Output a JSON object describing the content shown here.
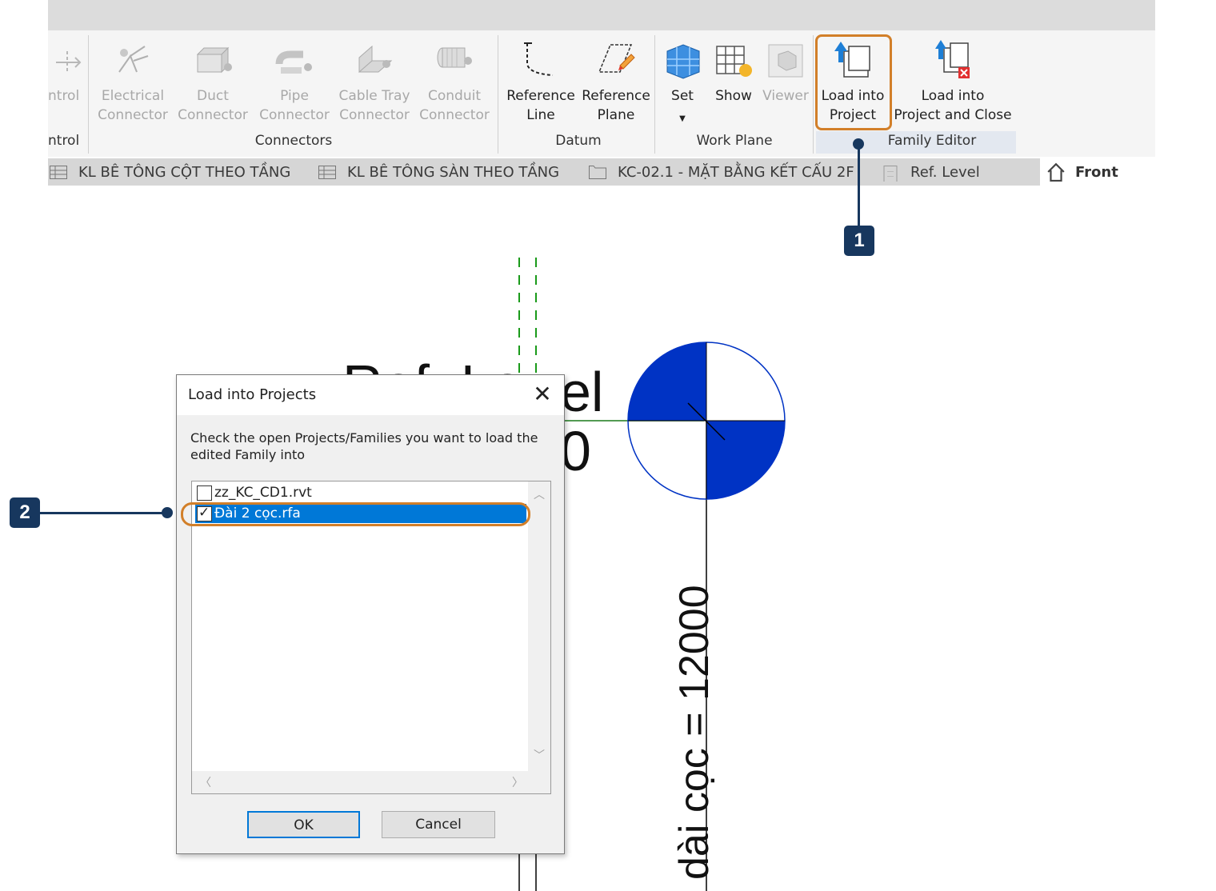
{
  "ribbon": {
    "control_label": "ntrol",
    "control_panel_title": "ntrol",
    "connectors": [
      {
        "label": "Electrical\nConnector",
        "icon": "electrical-connector-icon"
      },
      {
        "label": "Duct\nConnector",
        "icon": "duct-connector-icon"
      },
      {
        "label": "Pipe\nConnector",
        "icon": "pipe-connector-icon"
      },
      {
        "label": "Cable Tray\nConnector",
        "icon": "cable-tray-connector-icon"
      },
      {
        "label": "Conduit\nConnector",
        "icon": "conduit-connector-icon"
      }
    ],
    "connectors_panel_title": "Connectors",
    "reference_line": "Reference\nLine",
    "reference_plane": "Reference\nPlane",
    "datum_panel_title": "Datum",
    "set": "Set",
    "show": "Show",
    "viewer": "Viewer",
    "work_plane_panel_title": "Work Plane",
    "load_into_project": "Load into\nProject",
    "load_into_project_and_close": "Load into\nProject and Close",
    "family_editor_panel_title": "Family Editor"
  },
  "view_tabs": [
    {
      "label": "KL BÊ TÔNG CỘT THEO TẦNG",
      "icon": "schedule-icon"
    },
    {
      "label": "KL BÊ TÔNG SÀN THEO TẦNG",
      "icon": "schedule-icon"
    },
    {
      "label": "KC-02.1 - MẶT BẰNG KẾT CẤU 2F",
      "icon": "sheet-icon"
    },
    {
      "label": "Ref. Level",
      "icon": "level-view-icon"
    },
    {
      "label": "Front",
      "icon": "elevation-view-icon",
      "active": true
    }
  ],
  "callouts": {
    "one": "1",
    "two": "2"
  },
  "drawing": {
    "dimension_text": "dài cọc = 12000",
    "level_label_partial": "el",
    "level_value_partial": "0"
  },
  "dialog": {
    "title": "Load into Projects",
    "message": "Check the open Projects/Families you want to load the edited Family into",
    "items": [
      {
        "name": "zz_KC_CD1.rvt",
        "checked": false
      },
      {
        "name": "Đài 2 cọc.rfa",
        "checked": true,
        "selected": true
      }
    ],
    "ok": "OK",
    "cancel": "Cancel"
  },
  "colors": {
    "accent_blue": "#0078d7",
    "highlight_orange": "#d27f29",
    "callout_navy": "#17375e",
    "level_head_blue": "#0033c4"
  }
}
